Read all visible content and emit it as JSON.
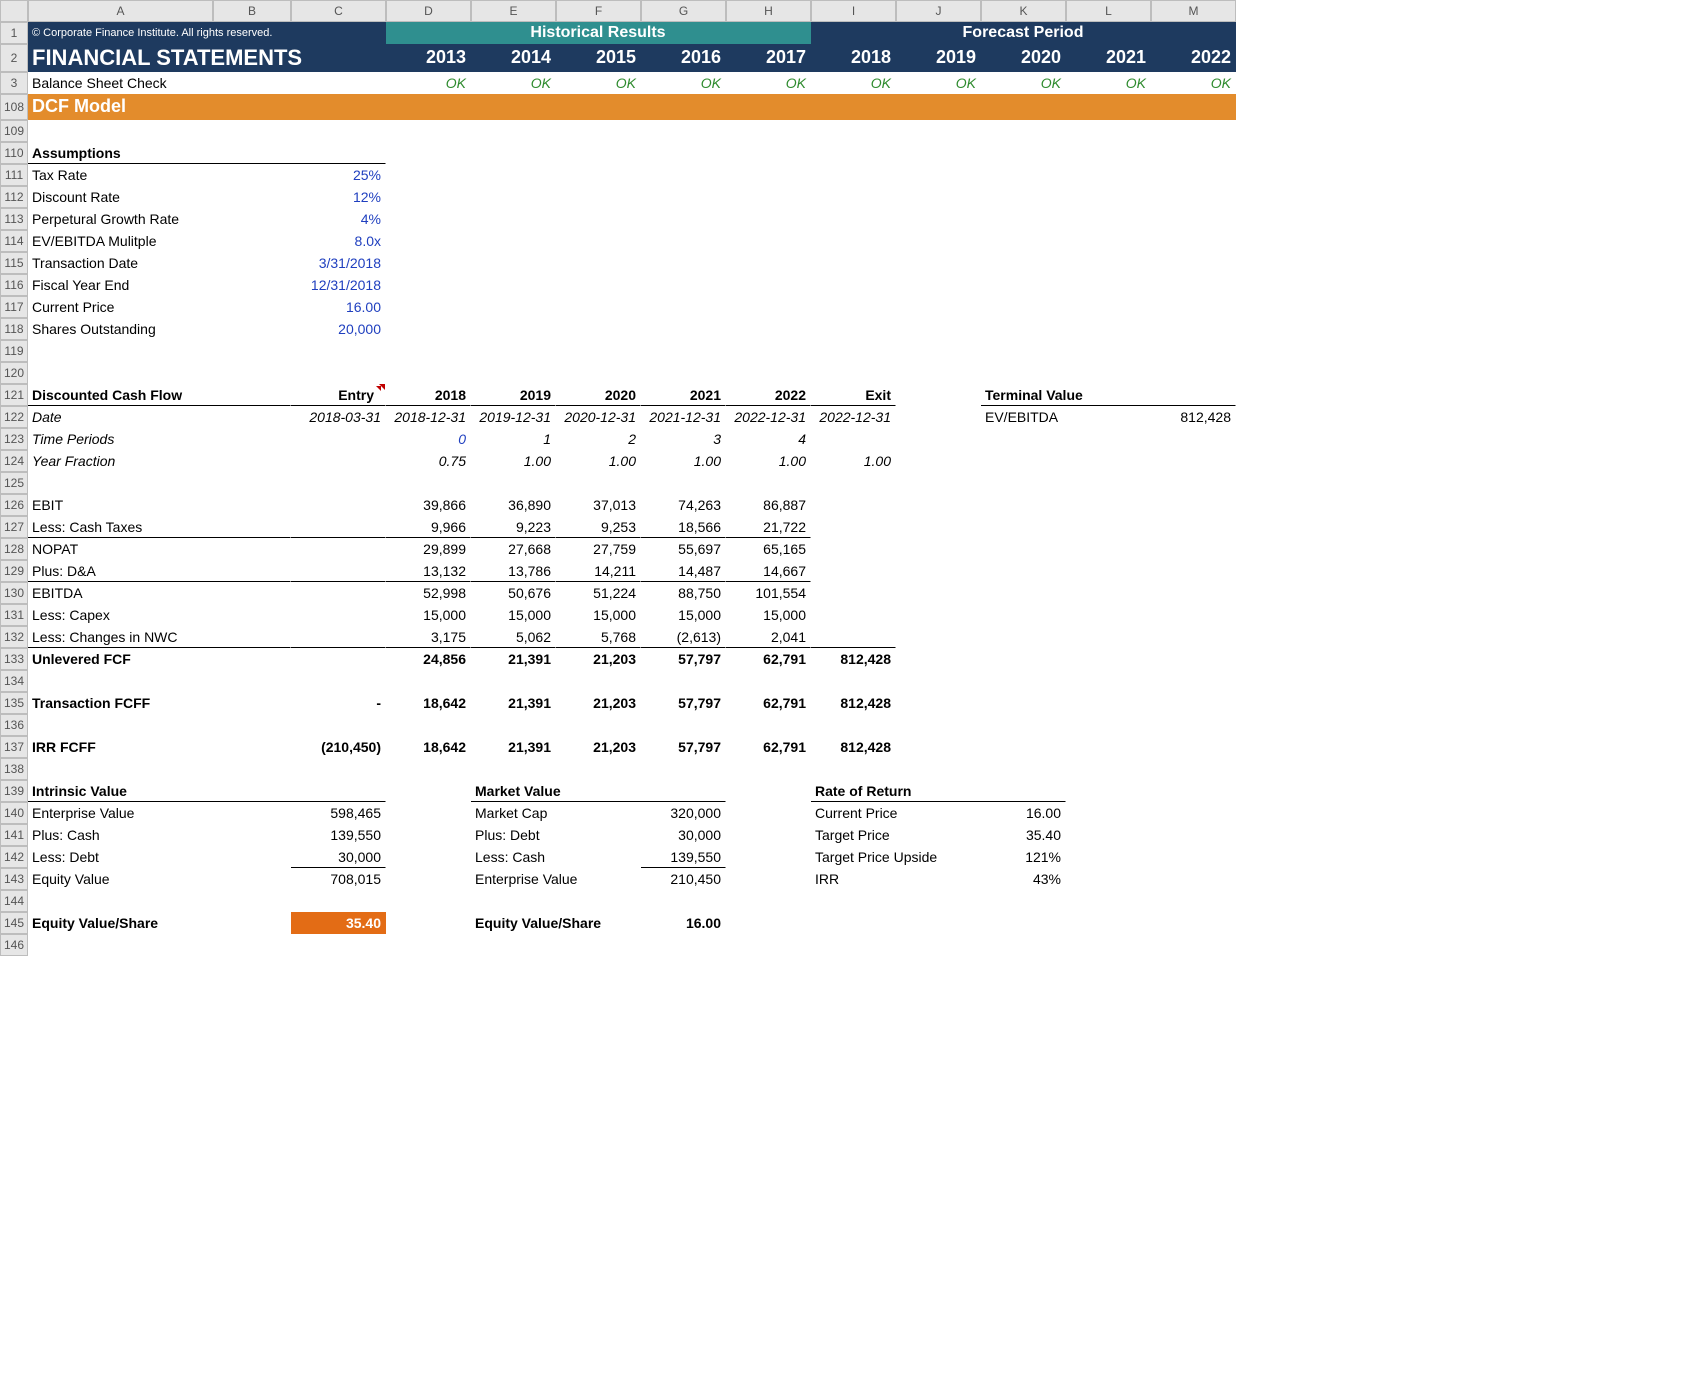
{
  "cols": [
    "",
    "A",
    "B",
    "C",
    "D",
    "E",
    "F",
    "G",
    "H",
    "I",
    "J",
    "K",
    "L",
    "M"
  ],
  "copyright": "© Corporate Finance Institute. All rights reserved.",
  "header_historical": "Historical Results",
  "header_forecast": "Forecast Period",
  "title_fin": "FINANCIAL STATEMENTS",
  "years_hist": [
    "2013",
    "2014",
    "2015",
    "2016",
    "2017"
  ],
  "years_fore": [
    "2018",
    "2019",
    "2020",
    "2021",
    "2022"
  ],
  "bs_check": "Balance Sheet Check",
  "ok": "OK",
  "dcf_model": "DCF Model",
  "assumptions_hdr": "Assumptions",
  "assumptions": [
    {
      "label": "Tax Rate",
      "value": "25%"
    },
    {
      "label": "Discount Rate",
      "value": "12%"
    },
    {
      "label": "Perpetural Growth Rate",
      "value": "4%"
    },
    {
      "label": "EV/EBITDA Mulitple",
      "value": "8.0x"
    },
    {
      "label": "Transaction Date",
      "value": "3/31/2018"
    },
    {
      "label": "Fiscal Year End",
      "value": "12/31/2018"
    },
    {
      "label": "Current Price",
      "value": "16.00"
    },
    {
      "label": "Shares Outstanding",
      "value": "20,000"
    }
  ],
  "dcf_header": {
    "label": "Discounted Cash Flow",
    "entry": "Entry",
    "y": [
      "2018",
      "2019",
      "2020",
      "2021",
      "2022"
    ],
    "exit": "Exit",
    "tv_label": "Terminal Value"
  },
  "date_row": {
    "label": "Date",
    "entry": "2018-03-31",
    "y": [
      "2018-12-31",
      "2019-12-31",
      "2020-12-31",
      "2021-12-31",
      "2022-12-31"
    ],
    "exit": "2022-12-31"
  },
  "tv_row": {
    "label": "EV/EBITDA",
    "value": "812,428"
  },
  "time_periods": {
    "label": "Time Periods",
    "y": [
      "0",
      "1",
      "2",
      "3",
      "4"
    ]
  },
  "year_fraction": {
    "label": "Year Fraction",
    "y": [
      "0.75",
      "1.00",
      "1.00",
      "1.00",
      "1.00"
    ],
    "exit": "1.00"
  },
  "lines": {
    "ebit": {
      "label": "EBIT",
      "y": [
        "39,866",
        "36,890",
        "37,013",
        "74,263",
        "86,887"
      ]
    },
    "taxes": {
      "label": "Less: Cash Taxes",
      "y": [
        "9,966",
        "9,223",
        "9,253",
        "18,566",
        "21,722"
      ]
    },
    "nopat": {
      "label": "NOPAT",
      "y": [
        "29,899",
        "27,668",
        "27,759",
        "55,697",
        "65,165"
      ]
    },
    "da": {
      "label": "Plus: D&A",
      "y": [
        "13,132",
        "13,786",
        "14,211",
        "14,487",
        "14,667"
      ]
    },
    "ebitda": {
      "label": "EBITDA",
      "y": [
        "52,998",
        "50,676",
        "51,224",
        "88,750",
        "101,554"
      ]
    },
    "capex": {
      "label": "Less: Capex",
      "y": [
        "15,000",
        "15,000",
        "15,000",
        "15,000",
        "15,000"
      ]
    },
    "nwc": {
      "label": "Less: Changes in NWC",
      "y": [
        "3,175",
        "5,062",
        "5,768",
        "(2,613)",
        "2,041"
      ]
    },
    "ufcf": {
      "label": "Unlevered FCF",
      "y": [
        "24,856",
        "21,391",
        "21,203",
        "57,797",
        "62,791"
      ],
      "exit": "812,428"
    },
    "tfcff": {
      "label": "Transaction FCFF",
      "entry": "-",
      "y": [
        "18,642",
        "21,391",
        "21,203",
        "57,797",
        "62,791"
      ],
      "exit": "812,428"
    },
    "irrfcff": {
      "label": "IRR FCFF",
      "entry": "(210,450)",
      "y": [
        "18,642",
        "21,391",
        "21,203",
        "57,797",
        "62,791"
      ],
      "exit": "812,428"
    }
  },
  "intrinsic_hdr": "Intrinsic Value",
  "market_hdr": "Market Value",
  "rate_hdr": "Rate of Return",
  "intrinsic": [
    {
      "label": "Enterprise Value",
      "value": "598,465"
    },
    {
      "label": "Plus: Cash",
      "value": "139,550"
    },
    {
      "label": "Less: Debt",
      "value": "30,000"
    },
    {
      "label": "Equity Value",
      "value": "708,015"
    }
  ],
  "market": [
    {
      "label": "Market Cap",
      "value": "320,000"
    },
    {
      "label": "Plus: Debt",
      "value": "30,000"
    },
    {
      "label": "Less: Cash",
      "value": "139,550"
    },
    {
      "label": "Enterprise Value",
      "value": "210,450"
    }
  ],
  "rate": [
    {
      "label": "Current Price",
      "value": "16.00"
    },
    {
      "label": "Target Price",
      "value": "35.40"
    },
    {
      "label": "Target Price Upside",
      "value": "121%"
    },
    {
      "label": "IRR",
      "value": "43%"
    }
  ],
  "evs_label": "Equity Value/Share",
  "evs_intrinsic": "35.40",
  "evs_market": "16.00",
  "row_nums": [
    "1",
    "2",
    "3",
    "108",
    "109",
    "110",
    "111",
    "112",
    "113",
    "114",
    "115",
    "116",
    "117",
    "118",
    "119",
    "120",
    "121",
    "122",
    "123",
    "124",
    "125",
    "126",
    "127",
    "128",
    "129",
    "130",
    "131",
    "132",
    "133",
    "134",
    "135",
    "136",
    "137",
    "138",
    "139",
    "140",
    "141",
    "142",
    "143",
    "144",
    "145",
    "146"
  ]
}
